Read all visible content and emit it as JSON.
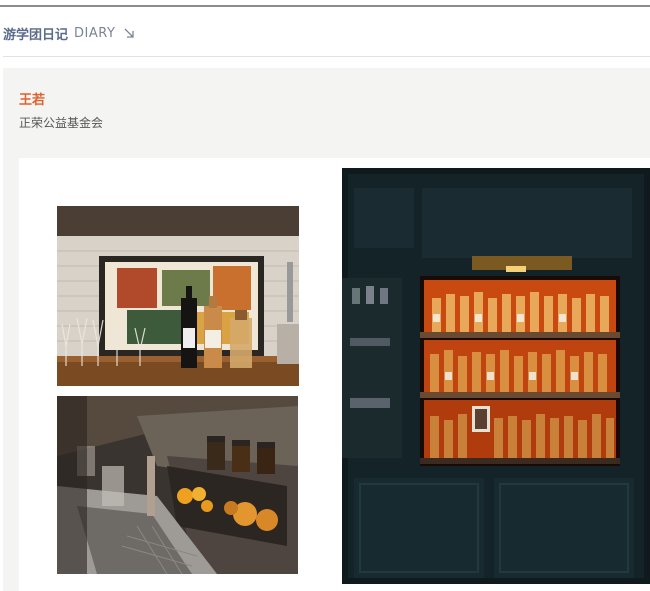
{
  "section": {
    "title_cn": "游学团日记",
    "title_en": "DIARY",
    "arrow_icon": "arrow-down-right-icon"
  },
  "entry": {
    "author": "王若",
    "organization": "正荣公益基金会"
  },
  "photos": [
    {
      "name": "bar-counter-photo",
      "subject": "bar counter with wine glasses, bottles and framed art"
    },
    {
      "name": "bar-prep-station-photo",
      "subject": "stainless steel bar prep station with oranges and jars"
    },
    {
      "name": "liquor-cabinet-photo",
      "subject": "dark cabinet with lit shelves of liquor bottles"
    }
  ],
  "colors": {
    "accent_orange": "#e0612d",
    "nav_blue": "#5a6b8c",
    "card_bg": "#f4f4f2"
  }
}
